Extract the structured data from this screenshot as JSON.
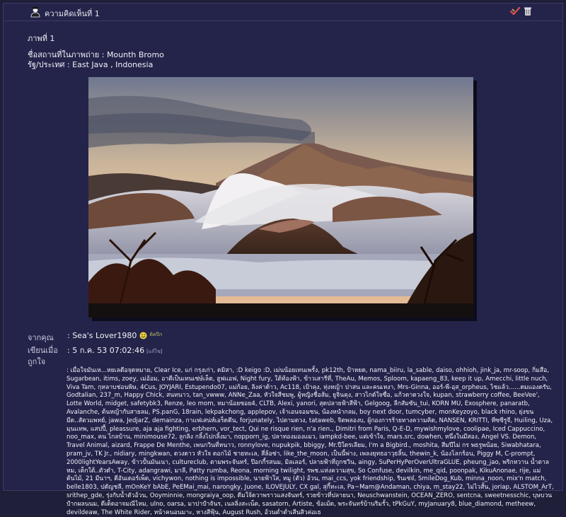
{
  "header": {
    "title": "ความคิดเห็นที่ 1",
    "user_icon": "user-avatar-icon",
    "actions": [
      {
        "icon": "like-check-icon",
        "name": "like-button"
      },
      {
        "icon": "trash-icon",
        "name": "delete-button"
      }
    ]
  },
  "post": {
    "image_title": "ภาพที่ 1",
    "place_line": "ชื่อสถานที่ในภาพถ่าย : Mounth Bromo",
    "state_line": "รัฐ/ประเทศ : East Java , Indonesia"
  },
  "meta": {
    "from_label": "จากคุณ",
    "from_value": ": Sea's Lover1980",
    "from_badge": "ติดปีก",
    "written_label": "เขียนเมื่อ",
    "written_value": ": 5 ก.ค. 53 07:02:46",
    "written_edit": "[แก้ไข]",
    "liked_label": "ถูกใจ",
    "liked_value": ": เมื่อใจมันเห...หยเลดีอจุดหมาย, Clear Ice, แก่ กรุงเก่า, ดมิสา, :D keigo :D, เม่นน้อยเทนเพรั้ง, pk12th, ป้าหยด, nama_biiru, la_sable, daiso, ohhioh, jink_ja, mr-soop, กิ่มสือ, Sugarbean, itims, zoey, เม่อ้อม, อาดีเป็นเทนเซ่ษ์เล็ต, ฮูฟแอฟ, Night fury, ใต้ท้องฟ้า, ข้าวเสารีที่, TheAu, Memos, Sploom, kapaeng_83, keep it up, Amecchi, little nuch, Viva Tam, กุหลาบช่อนพิษ, 4Cus, JOYJARI, Estupendo07, แม่ก้อย, ลิงค่าด้าว, Ac118, เป้าคุง, ทุ่งหญ้า ปาสน และคนเหงา, Mrs-Ginna, ออร์-พี-อุส_orpheus, ไซแล้ว......ดมแองดรับ, Godtalian, 237_m, Happy Chick, สนทนาว, tan_vwww, ANNe_Zaa, หัวใจสีชมพู, ผู้หญิงชื่อส้ม, ยูจินคุง, สาวไกด์ใจซื่อ, แก้วตาดวงใจ, kupan, strawberry coffee, BeeVee', Lotte World, midget, safetybk3, Renze, leo mom, หมาน้อยซอย4, CLTB, Alexi, yanori, สุดปลายฟ้าสีฟ้า, Gelgoog, ลีกสัมซัน_tui, KORN MU, Exosphere, panaratb, Avalanche, ต้นหญ้ากับสายลม, PS.panG, 18rain, lekpakchong, applepov, เจ้าเอนจอมซน, น้องหนำกลม, boy next door, tumcyber, monKeyzoyo, black rhino, ยุ่งขนมีด..สัตวแพทย์, jawa, JedjarZ, demainza, กาแฟเสน่ห์เอร็ดดึน, forjunately, ไปตามดวง, tataweb, จิตพลองบ, ผู้กองการร้ายทางความคิด, NANSEN, KRITTI, ทีซซีรูจี, Huiling, Uza, มุนแทพ, แสปปี้, pleassure, aja aja fighting, erbhern, vor_tect, Qui ne risque rien, n'a rien., Dimitri from Paris, Q-E-D, mywishmylove, coolipae, Iced Cappuccino, noo_max, คน ไกลบ้าน, minimouse72, ลูกลิง กลิ้งไปกลิ้งมา, nopporn_ig, ปลาทองมองแมว, iampkd-bee, แต่เข้าใจ, mars.src, dowhen, หนึ่งในมีสอง, Angel VS. Demon, Travel Animal, aizard, Frappe De Menthe, เพนกวินที่หนาว, ronnylove, nupukpik, bbiggy, Mr.ปีใดรเลียม, I'm a Bigbird., moshita, สีมปีไม่ กร พธรูพน้อย, Siwabhatara, pram_jv, TK Jr., nidiary, mingkwan, ดวงดาว หัวใจ ดอกไม้ ชายทะเล, สี่ล้อซ่า, like_the_moon, เป็นนี้พ่าง, เพลงยุทธอาวุธลิ้น, thewin_k, น้องโลกร้อน, Piggy M, C-prompt, 2000lightYearsAway, ข้าวปั้นมันเนา, cultureclub, ตามพระจันทร์, ป๊อกกี้รสนม, มิลเลอร์, ปลายฟ้าที่ถูกชวิน, aingy, SuPerHyPerOverUltraGLUE, pheung_jao, พริกหวาน น้ำตาลหม, เด็กใต้..ตัวดำ, T-City, adangrawi, มาลี, Patty rumba, Reona, morning twilight, รพช.แห่งความสุข, So Confuse, devilkin, me_qid, poonpak, KikuAnonae, rije, แม่ต้นไม้, 21 มีนาฯ, ดีอันเดอร์เพ็ด, vichywon, nothing is impossible, นายฟ้าใส, หมู (ตัว) อ้วน, mai_ccs, yok friendship, รินเซ่จ๋, SmileDog_Kub, minna_noon, mix'n match, belle1803, ปดัญชลี, mOnKeY bAbE, PeEMai_mai, narongky, Juone, ILOVEJULY, CX gal, สุกี้ทะเล, Pa~Mam@Andaman, chiya, m_stay22, ไม่ไวสั้น, joriap, ALSTOM_ArT, srithep_gde, รุ่งกับน้ำตัวอ้วน, Ooyminnie, mongraiya_oop, ดีมใจ้ดวาพราวแสงจันทร์, รวยข้าวที่ปลายนา, Neuschwanstein, OCEAN_ZERO, sentcna, sweetnesschic, บุษบวนปำกผลนนม, ดีเด็ดอาจมณีไหม, ulno, oarsa, มาปาปำจันร, เนลลิ่งสะเน็ด, sasatorn, Artiste, ข้อเม้ด, พระจันทร์บ้านริมรั้ว, tPkGuY, myJanuary8, blue_diamond, metheew, devildeaw, The White Rider, หน้าคนอนมาะ, หางสีฟุ้น, August Rush, อ้วนต่ำต่ำเสีนสิวค่อเธ"
  }
}
